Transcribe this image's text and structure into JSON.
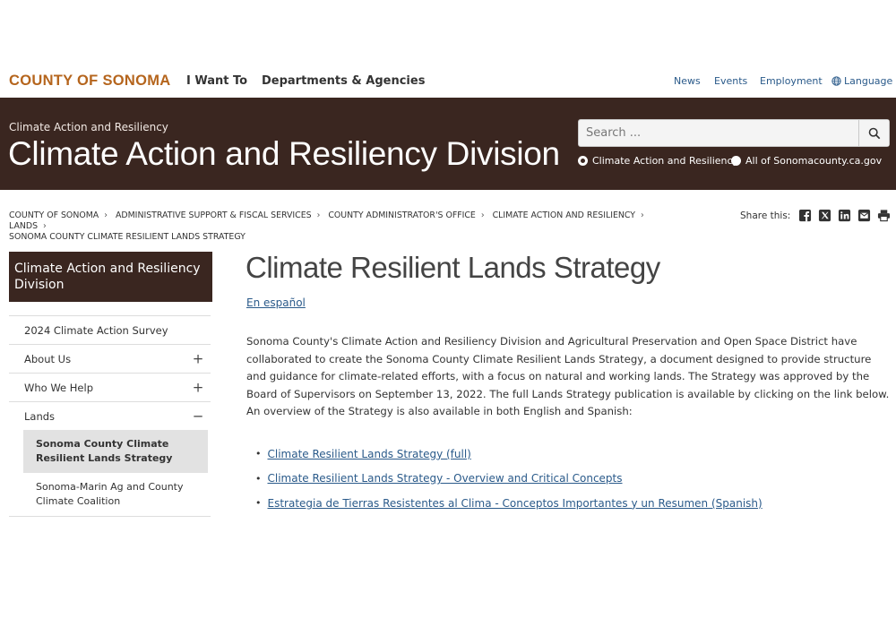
{
  "topnav": {
    "brand": "COUNTY OF SONOMA",
    "main_links": [
      "I Want To",
      "Departments & Agencies"
    ],
    "utility_links": [
      "News",
      "Events",
      "Employment",
      "Language"
    ]
  },
  "banner": {
    "subtitle": "Climate Action and Resiliency",
    "title": "Climate Action and Resiliency Division",
    "search": {
      "placeholder": "Search ...",
      "scopes": [
        "Climate Action and Resiliency",
        "All of Sonomacounty.ca.gov"
      ],
      "selected_scope": "Climate Action and Resiliency"
    }
  },
  "breadcrumb": {
    "items": [
      "COUNTY OF SONOMA",
      "ADMINISTRATIVE SUPPORT & FISCAL SERVICES",
      "COUNTY ADMINISTRATOR'S OFFICE",
      "CLIMATE ACTION AND RESILIENCY",
      "LANDS",
      "SONOMA COUNTY CLIMATE RESILIENT LANDS STRATEGY"
    ],
    "separator": "›"
  },
  "share": {
    "label": "Share this:",
    "icons": [
      "facebook-icon",
      "x-icon",
      "linkedin-icon",
      "email-icon",
      "print-icon"
    ]
  },
  "sidebar": {
    "title": "Climate Action and Resiliency Division",
    "items": [
      {
        "label": "2024 Climate Action Survey",
        "toggle": ""
      },
      {
        "label": "About Us",
        "toggle": "+"
      },
      {
        "label": "Who We Help",
        "toggle": "+"
      },
      {
        "label": "Lands",
        "toggle": "−"
      }
    ],
    "subitems": [
      {
        "label": "Sonoma County Climate Resilient Lands Strategy",
        "active": true
      },
      {
        "label": "Sonoma-Marin Ag and County Climate Coalition",
        "active": false
      }
    ]
  },
  "main": {
    "title": "Climate Resilient Lands Strategy",
    "spanish_link": "En español",
    "intro": "Sonoma County's Climate Action and Resiliency Division and Agricultural Preservation and Open Space District have collaborated to create the Sonoma County Climate Resilient Lands Strategy, a document designed to provide structure and guidance for climate-related efforts, with a focus on natural and working lands. The Strategy was approved by the Board of Supervisors on September 13, 2022. The full Lands Strategy publication is available by clicking on the link below. An overview of the Strategy is also available in both English and Spanish:",
    "links": [
      "Climate Resilient Lands Strategy (full)",
      "Climate Resilient Lands Strategy - Overview and Critical Concepts",
      "Estrategia de Tierras Resistentes al Clima - Conceptos Importantes y un Resumen (Spanish)"
    ]
  },
  "colors": {
    "brand": "#b5651d",
    "banner_bg": "#3a2620",
    "link": "#2a5a8a"
  }
}
